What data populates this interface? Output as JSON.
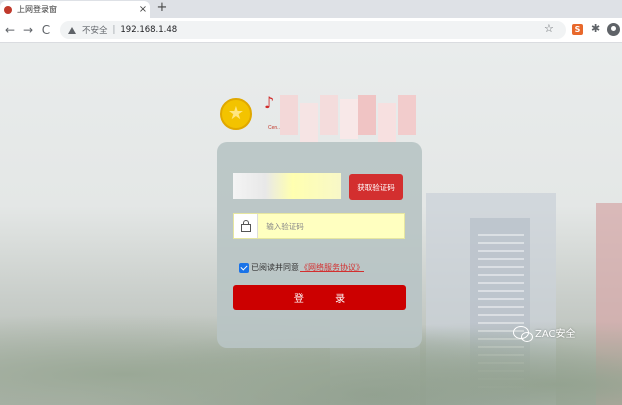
{
  "browser": {
    "tab_title": "上网登录窗",
    "tab_close": "×",
    "new_tab": "+",
    "back": "←",
    "forward": "→",
    "reload": "C",
    "security_label": "不安全",
    "separator": "|",
    "url": "192.168.1.48",
    "bookmark_star": "☆",
    "extension_label": "S",
    "puzzle": "✱"
  },
  "logo": {
    "emblem_glyph": "★",
    "subtitle": "Cen...",
    "mark_glyph": "♪"
  },
  "login_form": {
    "get_code_label": "获取验证码",
    "code_placeholder": "输入验证码",
    "agree_text": "已阅读并同意",
    "agreement_link": "《网络服务协议》",
    "login_label": "登 录"
  },
  "watermark": {
    "text": "ZAC安全"
  },
  "colors": {
    "primary_red": "#cc0000",
    "button_red": "#d32f2f",
    "emblem_gold": "#f3c300",
    "card_gray": "#b8c4c4",
    "input_yellow": "#ffffc0"
  }
}
